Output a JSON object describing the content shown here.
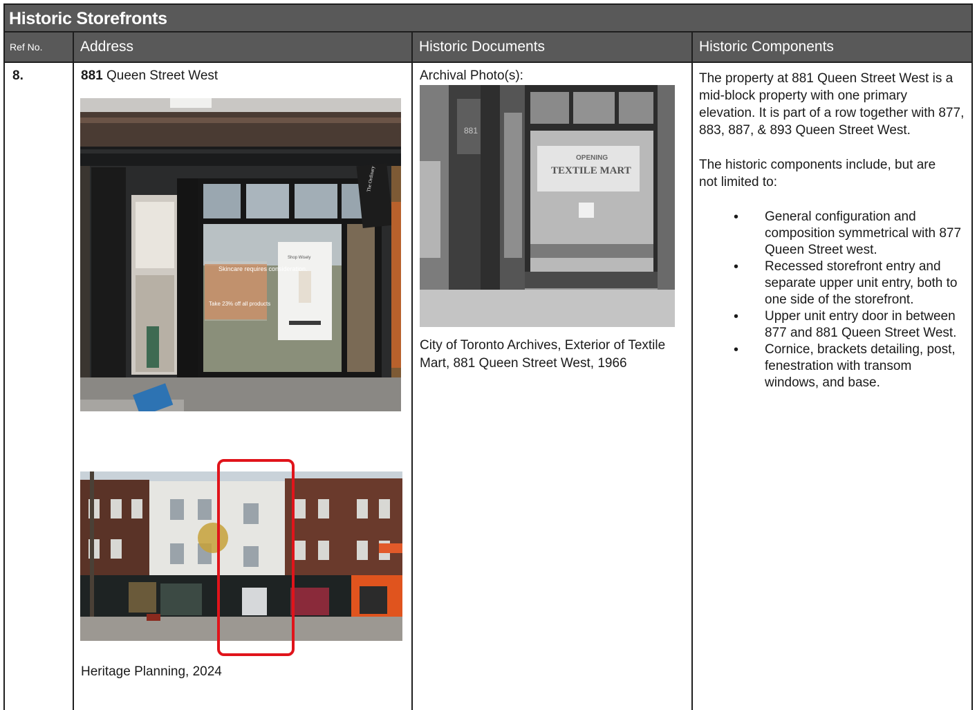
{
  "title": "Historic Storefronts",
  "headers": {
    "ref": "Ref No.",
    "address": "Address",
    "documents": "Historic Documents",
    "components": "Historic Components"
  },
  "row": {
    "ref": "8.",
    "address_number": "881",
    "address_street": " Queen Street West",
    "photo_caption": "Heritage Planning, 2024",
    "archival_label": "Archival Photo(s):",
    "archival_caption": "City of Toronto Archives, Exterior of Textile Mart, 881 Queen Street West, 1966",
    "intro": "The property at 881 Queen Street West is a mid-block property with one primary elevation. It is part of a row together with 877, 883, 887, & 893 Queen Street West.",
    "components_lead": "The historic components include, but are not limited to:",
    "components": [
      "General configuration and composition symmetrical with 877 Queen Street west.",
      "Recessed storefront entry and separate upper unit entry, both to one side of the storefront.",
      "Upper unit entry door in between 877 and 881 Queen Street West.",
      "Cornice, brackets detailing, post, fenestration with transom windows, and base."
    ]
  },
  "images": {
    "storefront_sign_brand": "The Ordinary",
    "storefront_poster_left": "Skincare requires consideration.",
    "storefront_poster_left_2": "Take 23% off all products",
    "storefront_poster_right": "Shop Wisely",
    "archival_sign_1": "OPENING",
    "archival_sign_2": "TEXTILE MART",
    "archival_number": "881"
  },
  "colors": {
    "header_bg": "#595959",
    "border": "#1e1e1e",
    "highlight": "#e0141b"
  }
}
